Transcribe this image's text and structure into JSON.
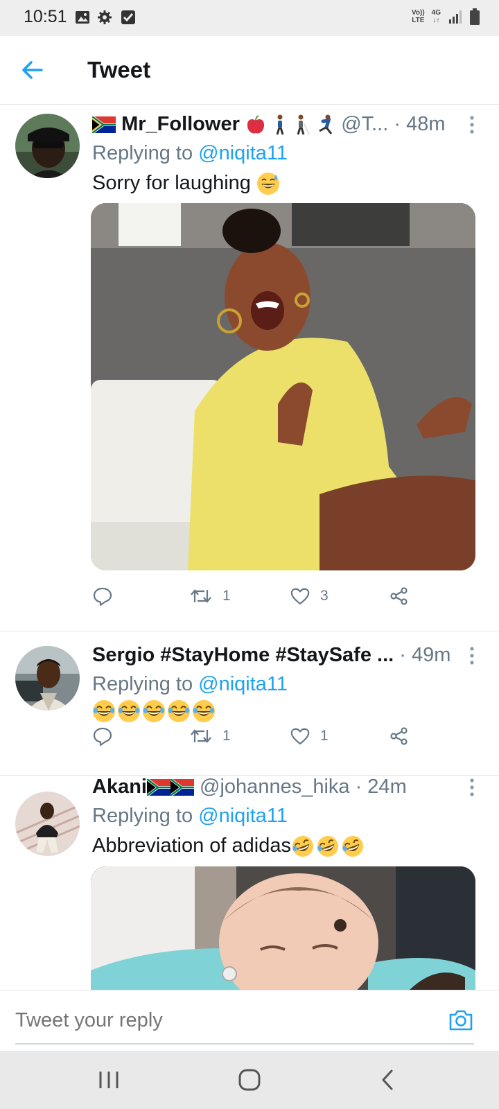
{
  "status_bar": {
    "time": "10:51",
    "network_top": "Vo))",
    "network_bottom": "LTE",
    "signal_label": "4G"
  },
  "header": {
    "title": "Tweet"
  },
  "tweets": [
    {
      "name": "Mr_Follower",
      "handle": "@T...",
      "time": "· 48m",
      "replying_prefix": "Replying to ",
      "replying_to": "@niqita11",
      "text": "Sorry for laughing",
      "retweets": "1",
      "likes": "3"
    },
    {
      "name": "Sergio #StayHome #StaySafe ...",
      "time": "· 49m",
      "replying_prefix": "Replying to ",
      "replying_to": "@niqita11",
      "retweets": "1",
      "likes": "1"
    },
    {
      "name": "Akani",
      "handle": "@johannes_hika",
      "time": "· 24m",
      "replying_prefix": "Replying to ",
      "replying_to": "@niqita11",
      "text": "Abbreviation of adidas"
    }
  ],
  "reply_bar": {
    "placeholder": "Tweet your reply"
  },
  "colors": {
    "accent": "#1da1f2",
    "secondary_text": "#657786"
  }
}
